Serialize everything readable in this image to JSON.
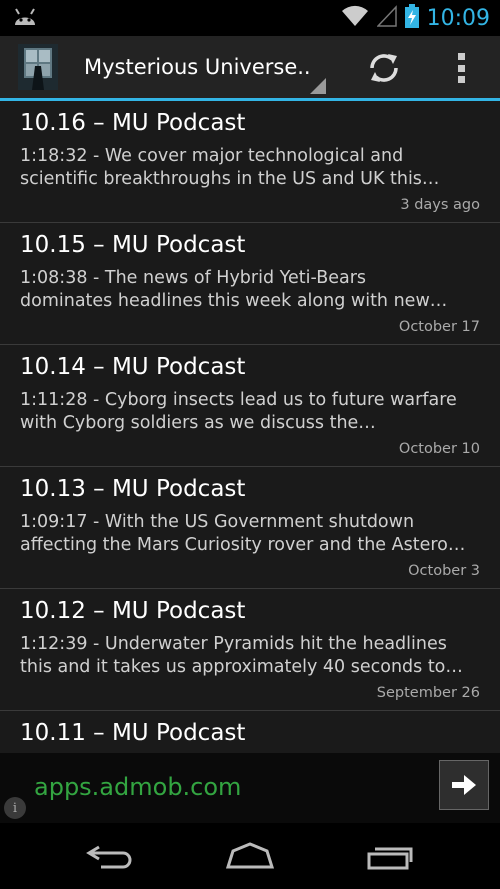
{
  "status_bar": {
    "time": "10:09",
    "icons": [
      "android-icon",
      "wifi-icon",
      "signal-icon",
      "battery-charging-icon"
    ],
    "accent_color": "#33b5e5"
  },
  "action_bar": {
    "title": "Mysterious Universe..",
    "icons": [
      "app-thumbnail",
      "refresh-icon",
      "overflow-menu-icon"
    ]
  },
  "episodes": [
    {
      "title": "10.16 – MU Podcast",
      "desc_line1": "1:18:32 - We cover major technological and",
      "desc_line2": "scientific breakthroughs in the US and UK this…",
      "date": "3 days ago"
    },
    {
      "title": "10.15 – MU Podcast",
      "desc_line1": "1:08:38 - The news of Hybrid Yeti-Bears",
      "desc_line2": "dominates headlines this week along with new…",
      "date": "October 17"
    },
    {
      "title": "10.14 – MU Podcast",
      "desc_line1": "1:11:28 - Cyborg insects lead us to future warfare",
      "desc_line2": "with Cyborg soldiers as we discuss the…",
      "date": "October 10"
    },
    {
      "title": "10.13 – MU Podcast",
      "desc_line1": "1:09:17 - With the US Government shutdown",
      "desc_line2": "affecting the Mars Curiosity rover and the Astero…",
      "date": "October 3"
    },
    {
      "title": "10.12 – MU Podcast",
      "desc_line1": "1:12:39 - Underwater Pyramids hit the headlines",
      "desc_line2": "this and it takes us approximately 40 seconds to…",
      "date": "September 26"
    },
    {
      "title": "10.11 – MU Podcast",
      "desc_line1": "",
      "desc_line2": "",
      "date": ""
    }
  ],
  "ad": {
    "text": "apps.admob.com",
    "text_color": "#33a541",
    "icons": [
      "arrow-right-icon",
      "info-icon"
    ]
  },
  "nav_bar": {
    "icons": [
      "back-icon",
      "home-icon",
      "recents-icon"
    ]
  }
}
